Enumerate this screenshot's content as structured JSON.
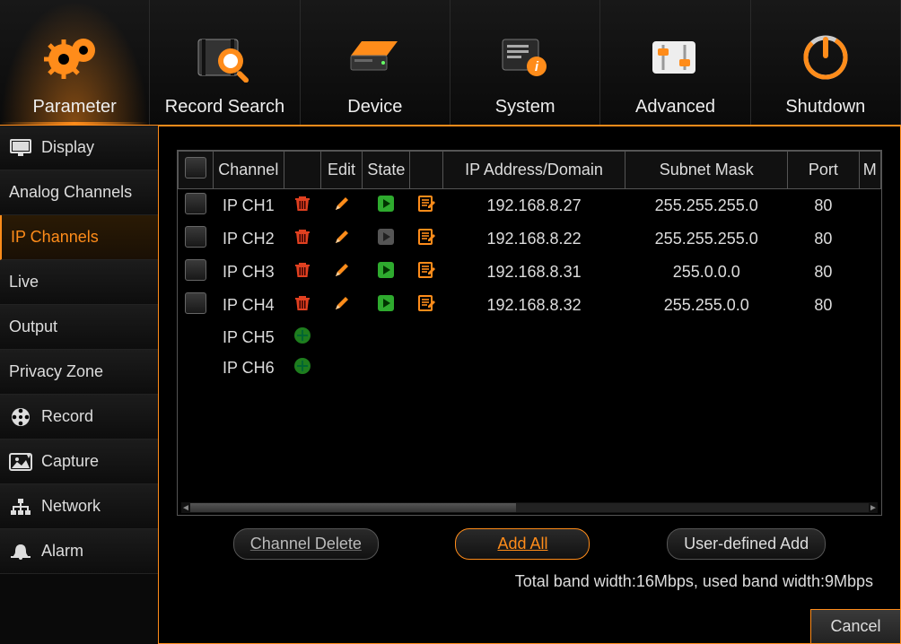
{
  "topnav": [
    {
      "id": "parameter",
      "label": "Parameter",
      "active": true
    },
    {
      "id": "record-search",
      "label": "Record Search"
    },
    {
      "id": "device",
      "label": "Device"
    },
    {
      "id": "system",
      "label": "System"
    },
    {
      "id": "advanced",
      "label": "Advanced"
    },
    {
      "id": "shutdown",
      "label": "Shutdown"
    }
  ],
  "sidebar": [
    {
      "id": "display",
      "label": "Display",
      "icon": "monitor"
    },
    {
      "id": "analog-channels",
      "label": "Analog Channels",
      "sub": true
    },
    {
      "id": "ip-channels",
      "label": "IP Channels",
      "sub": true,
      "active": true
    },
    {
      "id": "live",
      "label": "Live",
      "sub": true
    },
    {
      "id": "output",
      "label": "Output",
      "sub": true
    },
    {
      "id": "privacy-zone",
      "label": "Privacy Zone",
      "sub": true
    },
    {
      "id": "record",
      "label": "Record",
      "icon": "reel"
    },
    {
      "id": "capture",
      "label": "Capture",
      "icon": "capture"
    },
    {
      "id": "network",
      "label": "Network",
      "icon": "network"
    },
    {
      "id": "alarm",
      "label": "Alarm",
      "icon": "bell"
    }
  ],
  "table": {
    "headers": {
      "channel": "Channel",
      "edit": "Edit",
      "state": "State",
      "ip": "IP Address/Domain",
      "mask": "Subnet Mask",
      "port": "Port",
      "m": "M"
    },
    "rows": [
      {
        "channel": "IP CH1",
        "state": "play-green",
        "ip": "192.168.8.27",
        "mask": "255.255.255.0",
        "port": "80"
      },
      {
        "channel": "IP CH2",
        "state": "play-gray",
        "ip": "192.168.8.22",
        "mask": "255.255.255.0",
        "port": "80"
      },
      {
        "channel": "IP CH3",
        "state": "play-green",
        "ip": "192.168.8.31",
        "mask": "255.0.0.0",
        "port": "80"
      },
      {
        "channel": "IP CH4",
        "state": "play-green",
        "ip": "192.168.8.32",
        "mask": "255.255.0.0",
        "port": "80"
      }
    ],
    "empty_rows": [
      {
        "channel": "IP CH5"
      },
      {
        "channel": "IP CH6"
      }
    ]
  },
  "buttons": {
    "channel_delete": "Channel Delete",
    "add_all": "Add All",
    "user_defined_add": "User-defined Add",
    "cancel": "Cancel"
  },
  "bandwidth": "Total band width:16Mbps, used band width:9Mbps"
}
